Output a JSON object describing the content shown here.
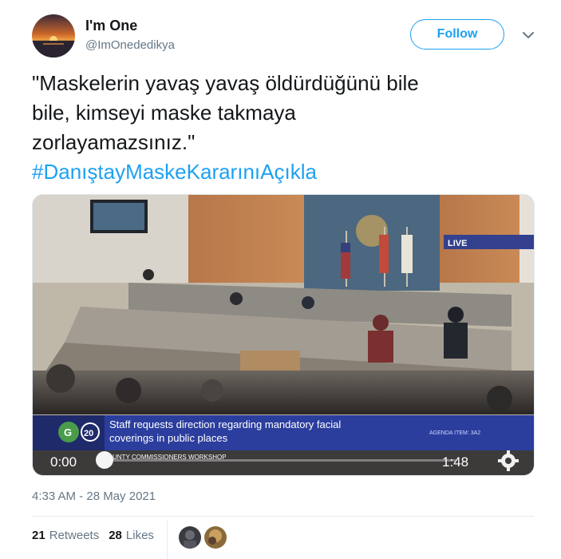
{
  "author": {
    "display_name": "I'm One",
    "handle": "@ImOnededikya",
    "avatar_icon": "sunset-avatar-icon"
  },
  "follow_button": {
    "label": "Follow"
  },
  "tweet": {
    "lines": [
      "\"Maskelerin yavaş yavaş öldürdüğünü bile",
      "bile, kimseyi maske takmaya",
      "zorlayamazsınız.\""
    ],
    "hashtag": "#DanıştayMaskeKararınıAçıkla"
  },
  "video": {
    "live_badge": "LIVE",
    "ticker_line1": "Staff requests direction regarding mandatory facial",
    "ticker_line2": "coverings in public places",
    "ticker_sub": "UNTY COMMISSIONERS WORKSHOP",
    "agenda": "AGENDA ITEM: 3A2",
    "channel": "20",
    "time_current": "0:00",
    "time_total": "1:48",
    "progress": 0
  },
  "timestamp": "4:33 AM - 28 May 2021",
  "stats": {
    "retweets_count": "21",
    "retweets_label": "Retweets",
    "likes_count": "28",
    "likes_label": "Likes"
  },
  "colors": {
    "accent": "#1da1f2",
    "text": "#14171a",
    "muted": "#657786",
    "ticker_blue": "#2b3e9e"
  }
}
